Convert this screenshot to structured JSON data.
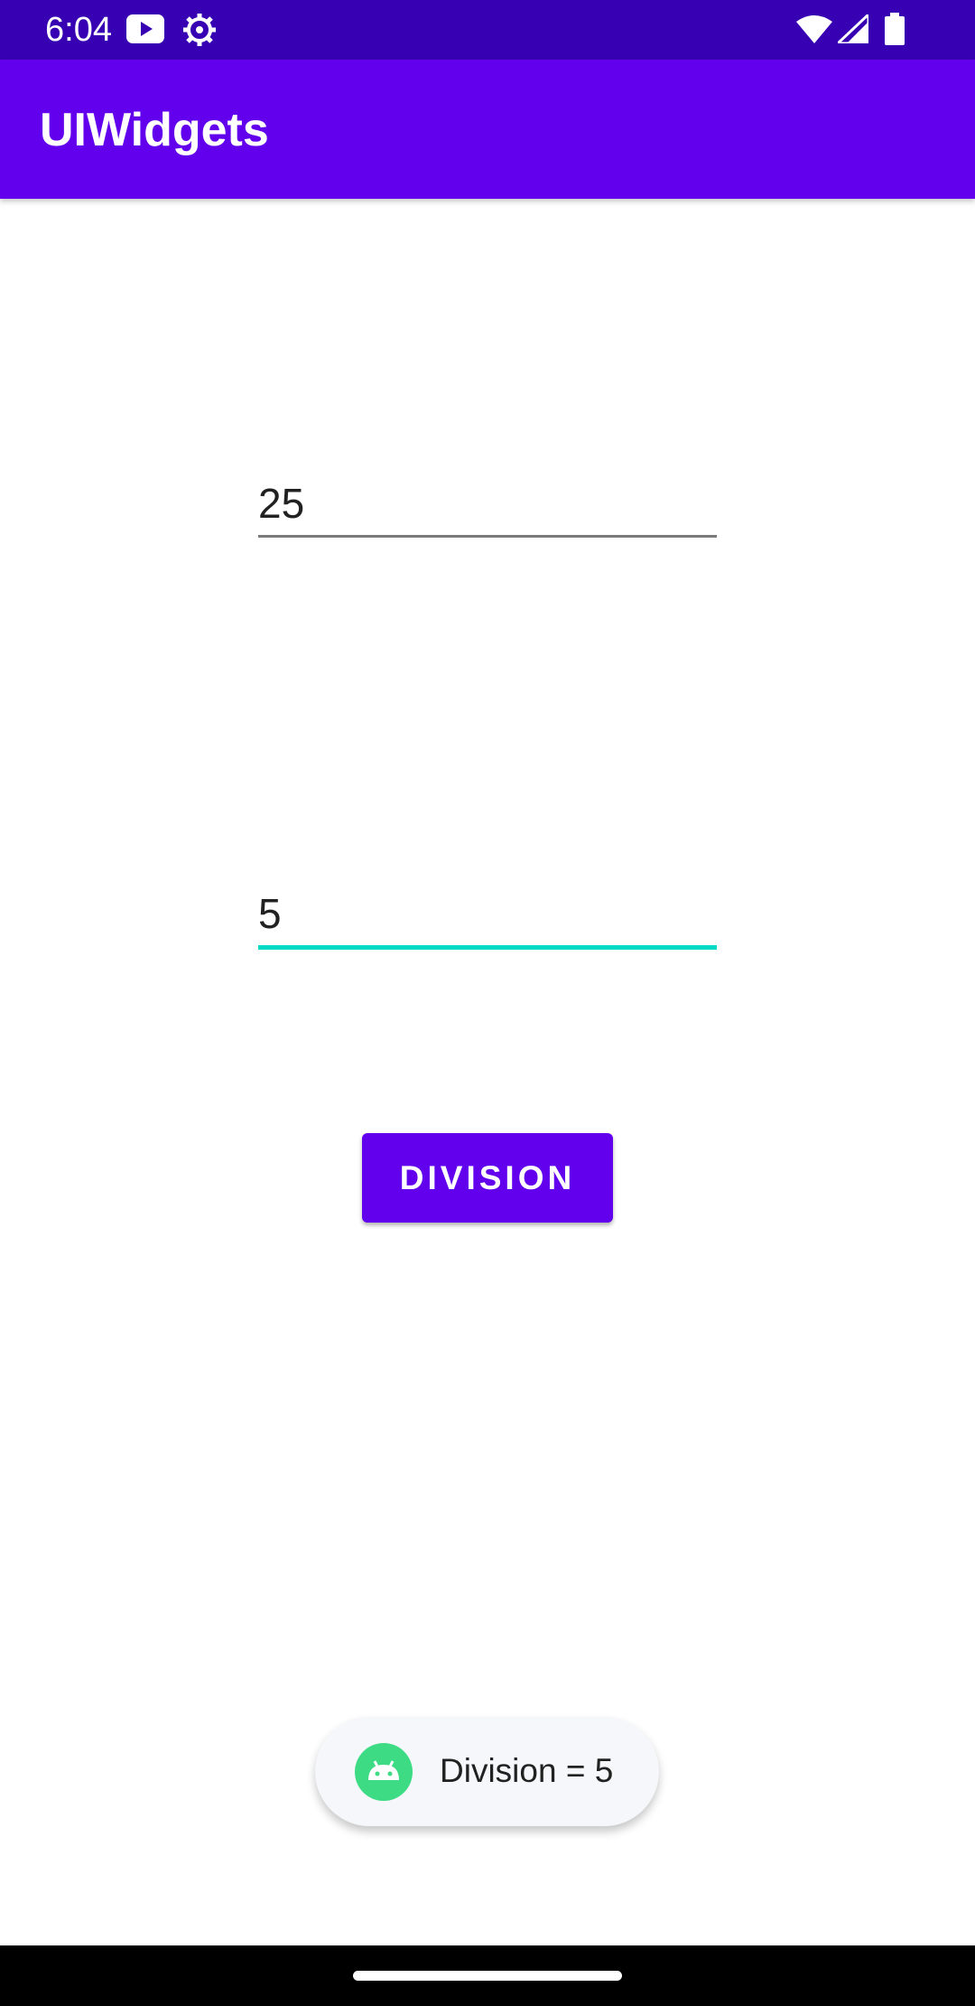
{
  "status_bar": {
    "time": "6:04",
    "icons": [
      "youtube-icon",
      "settings-icon",
      "wifi-icon",
      "signal-icon",
      "battery-icon"
    ],
    "color": "#3700b3"
  },
  "app_bar": {
    "title": "UIWidgets",
    "color": "#6200ee"
  },
  "form": {
    "first_number": "25",
    "second_number": "5",
    "focused_field": "second_number",
    "focus_color": "#03dac5"
  },
  "actions": {
    "division_label": "DIVISION"
  },
  "toast": {
    "message": "Division = 5",
    "icon": "android-icon"
  },
  "nav": {
    "handle": "gesture-handle"
  }
}
